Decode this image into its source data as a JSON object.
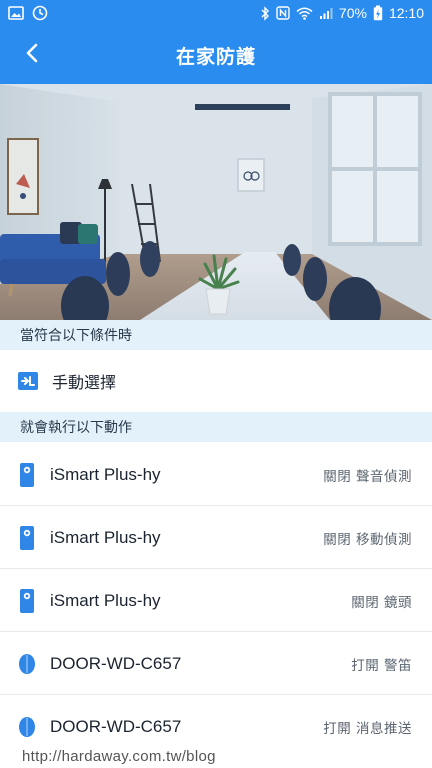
{
  "status_bar": {
    "battery": "70%",
    "time": "12:10"
  },
  "app_bar": {
    "title": "在家防護",
    "back_icon": "chevron-left-icon"
  },
  "conditions": {
    "header": "當符合以下條件時",
    "trigger": {
      "icon": "manual-select-icon",
      "label": "手動選擇"
    }
  },
  "actions": {
    "header": "就會執行以下動作",
    "items": [
      {
        "device": "iSmart Plus-hy",
        "action": "關閉 聲音偵測",
        "icon": "camera-device-icon"
      },
      {
        "device": "iSmart Plus-hy",
        "action": "關閉 移動偵測",
        "icon": "camera-device-icon"
      },
      {
        "device": "iSmart Plus-hy",
        "action": "關閉 鏡頭",
        "icon": "camera-device-icon"
      },
      {
        "device": "DOOR-WD-C657",
        "action": "打開 警笛",
        "icon": "door-sensor-icon"
      },
      {
        "device": "DOOR-WD-C657",
        "action": "打開 消息推送",
        "icon": "door-sensor-icon"
      }
    ]
  },
  "watermark": "http://hardaway.com.tw/blog",
  "colors": {
    "primary": "#2b8cf0",
    "section_bg": "#e3f1fb",
    "device_icon": "#2f86e6"
  }
}
